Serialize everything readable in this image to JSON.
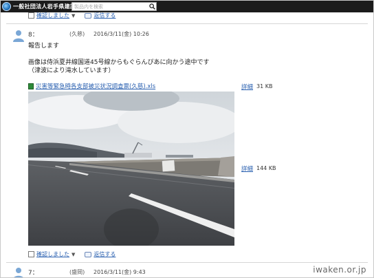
{
  "header": {
    "org_name": "一般社団法人岩手県建設業協会",
    "search_placeholder": "製品内を検索"
  },
  "actions_top": {
    "confirm_label": "確認しました",
    "reply_label": "返信する"
  },
  "post8": {
    "number": "8：",
    "author": "(久慈)",
    "date": "2016/3/11(金) 10:26",
    "body_lines": [
      "報告します",
      "",
      "画像は侍浜夏井線国道45号線からもぐらんぴあに向かう途中です",
      "（津波により滝水しています）"
    ],
    "attachment_name": "災害等緊急時各支部被災状況調査票(久慈).xls",
    "attachment_detail": "詳細",
    "attachment_size": "31 KB",
    "image_detail": "詳細",
    "image_size": "144 KB"
  },
  "actions_bottom": {
    "confirm_label": "確認しました",
    "reply_label": "返信する"
  },
  "post7": {
    "number": "7：",
    "author": "(盛岡)",
    "date": "2016/3/11(金) 9:43"
  },
  "watermark": "iwaken.or.jp"
}
